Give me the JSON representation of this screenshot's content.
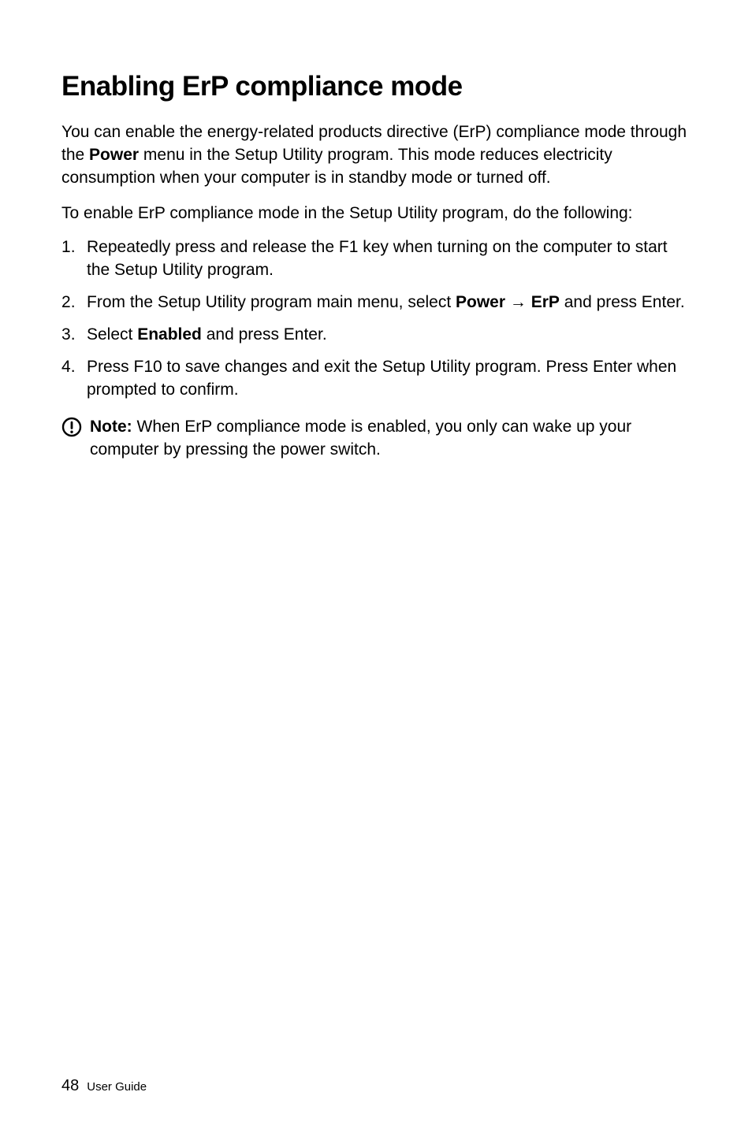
{
  "heading": "Enabling ErP compliance mode",
  "intro": {
    "part1": "You can enable the energy-related products directive (ErP) compliance mode through the ",
    "bold1": "Power",
    "part2": " menu in the Setup Utility program. This mode reduces electricity consumption when your computer is in standby mode or turned off."
  },
  "lead": "To enable ErP compliance mode in the Setup Utility program, do the following:",
  "steps": [
    {
      "parts": [
        {
          "text": "Repeatedly press and release the F1 key when turning on the computer to start the Setup Utility program."
        }
      ]
    },
    {
      "parts": [
        {
          "text": "From the Setup Utility program main menu, select "
        },
        {
          "text": "Power → ErP",
          "bold": true
        },
        {
          "text": " and press Enter."
        }
      ]
    },
    {
      "parts": [
        {
          "text": "Select "
        },
        {
          "text": "Enabled",
          "bold": true
        },
        {
          "text": " and press Enter."
        }
      ]
    },
    {
      "parts": [
        {
          "text": "Press F10 to save changes and exit the Setup Utility program. Press Enter when prompted to confirm."
        }
      ]
    }
  ],
  "note": {
    "label": "Note:",
    "body": " When ErP compliance mode is enabled, you only can wake up your computer by pressing the power switch."
  },
  "footer": {
    "pageNumber": "48",
    "label": "User Guide"
  }
}
